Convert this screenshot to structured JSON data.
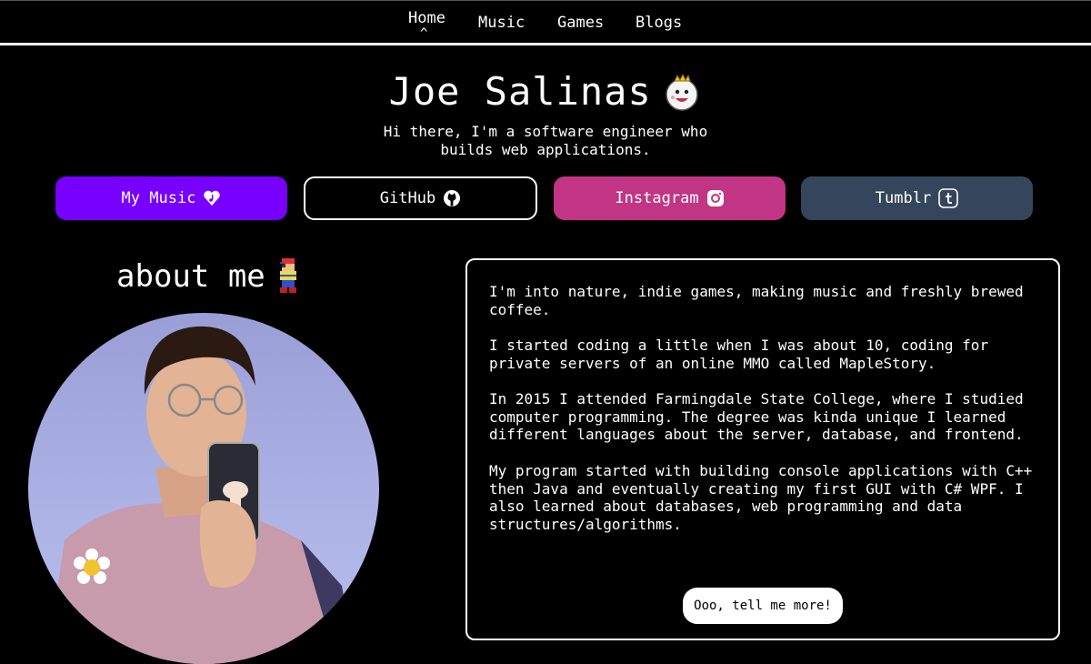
{
  "nav": {
    "items": [
      {
        "label": "Home",
        "active": true
      },
      {
        "label": "Music"
      },
      {
        "label": "Games"
      },
      {
        "label": "Blogs"
      }
    ],
    "active_indicator": "^"
  },
  "header": {
    "name": "Joe Salinas",
    "name_icon": "king-boo-ghost-icon",
    "tagline": "Hi there, I'm a software engineer who builds web applications."
  },
  "links": [
    {
      "label": "My Music",
      "icon": "heart-music-icon",
      "bg": "#7700ff"
    },
    {
      "label": "GitHub",
      "icon": "github-icon",
      "bg": "#000000"
    },
    {
      "label": "Instagram",
      "icon": "instagram-icon",
      "bg": "#c13584"
    },
    {
      "label": "Tumblr",
      "icon": "tumblr-icon",
      "bg": "#35465c"
    }
  ],
  "about": {
    "title": "about me",
    "title_icon": "pixel-character-icon",
    "photo": "profile-photo",
    "paragraphs": [
      "I'm into nature, indie games, making music and freshly brewed coffee.",
      "I started coding a little when I was about 10, coding for private servers of an online MMO called MapleStory.",
      "In 2015 I attended Farmingdale State College, where I studied computer programming. The degree was kinda unique I learned different languages about the server, database, and frontend.",
      "My program started with building console applications with C++ then Java and eventually creating my first GUI with C# WPF. I also learned about databases, web programming and data structures/algorithms."
    ],
    "more_button": "Ooo, tell me more!"
  }
}
